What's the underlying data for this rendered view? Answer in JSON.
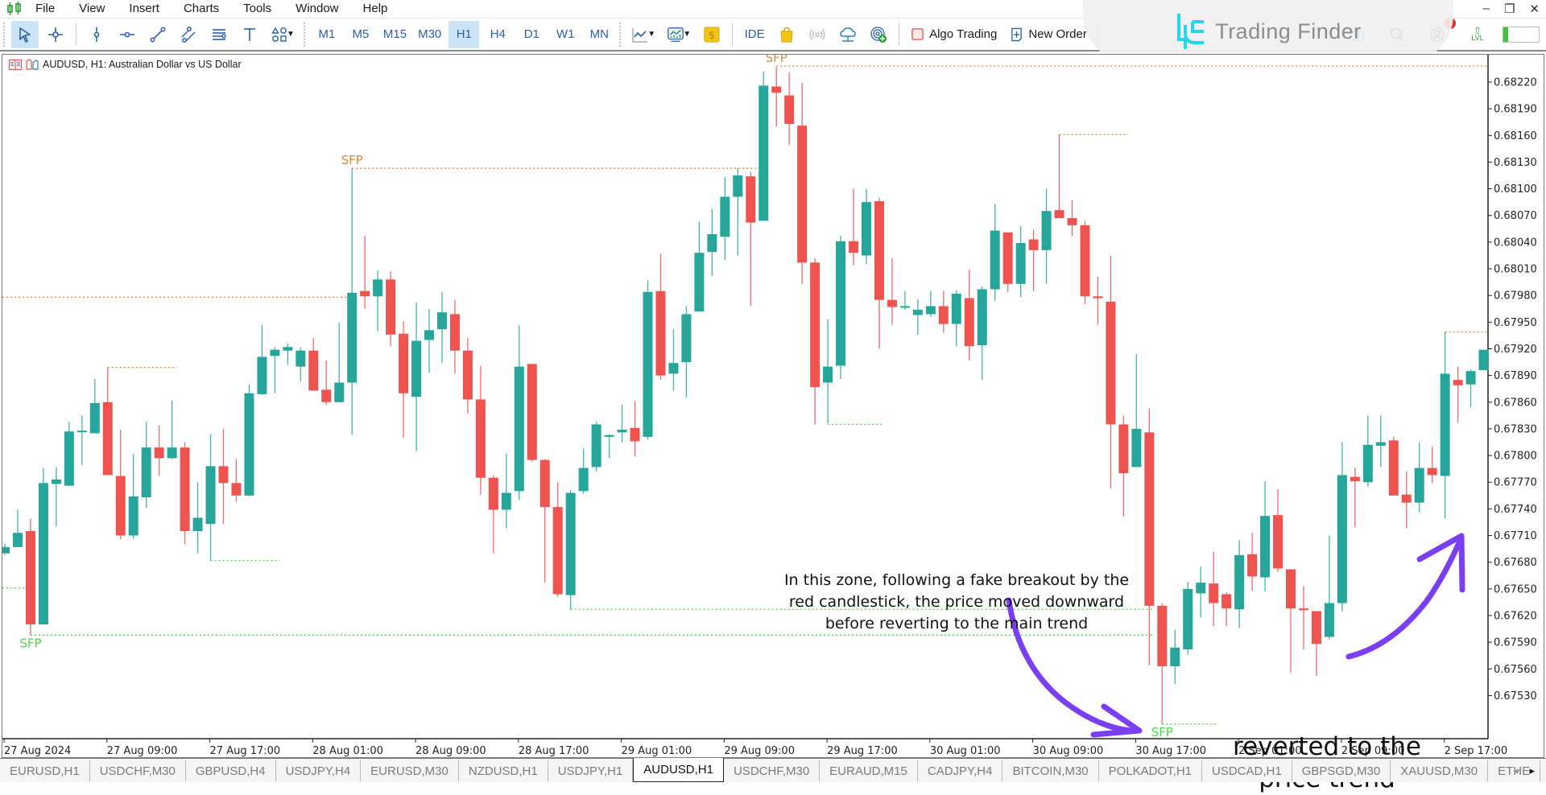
{
  "app": {
    "menu": [
      "File",
      "View",
      "Insert",
      "Charts",
      "Tools",
      "Window",
      "Help"
    ],
    "window_controls": {
      "minimize": "–",
      "restore": "❐",
      "close": "✕"
    }
  },
  "toolbar": {
    "drawing_tools": [
      "cursor-icon",
      "crosshair-icon",
      "vertical-line-icon",
      "horizontal-line-icon",
      "trendline-icon",
      "equidistant-channel-icon",
      "fibonacci-icon",
      "text-icon",
      "shapes-icon"
    ],
    "timeframes": [
      "M1",
      "M5",
      "M15",
      "M30",
      "H1",
      "H4",
      "D1",
      "W1",
      "MN"
    ],
    "active_timeframe": "H1",
    "ide_label": "IDE",
    "algo_trading_label": "Algo Trading",
    "new_order_label": "New Order",
    "notification_count": "1",
    "level_label": "LVL"
  },
  "watermark": {
    "brand": "Trading Finder"
  },
  "chart": {
    "title": "AUDUSD, H1:  Australian Dollar vs US Dollar",
    "symbol": "AUDUSD",
    "timeframe": "H1",
    "colors": {
      "bull": "#26a69a",
      "bear": "#ef5350",
      "sfp_high": "#e08a3c",
      "sfp_low": "#4cd94c",
      "arrow": "#7b3ff2"
    }
  },
  "annotations": {
    "zone_note": "In this zone, following a fake breakout by the red candlestick, the price moved downward before reverting to the main trend",
    "trend_note": "reverted to the price trend"
  },
  "tabs": [
    {
      "label": "EURUSD,H1",
      "active": false
    },
    {
      "label": "USDCHF,M30",
      "active": false
    },
    {
      "label": "GBPUSD,H4",
      "active": false
    },
    {
      "label": "USDJPY,H4",
      "active": false
    },
    {
      "label": "EURUSD,M30",
      "active": false
    },
    {
      "label": "NZDUSD,H1",
      "active": false
    },
    {
      "label": "USDJPY,H1",
      "active": false
    },
    {
      "label": "AUDUSD,H1",
      "active": true
    },
    {
      "label": "USDCHF,M30",
      "active": false
    },
    {
      "label": "EURAUD,M15",
      "active": false
    },
    {
      "label": "CADJPY,H4",
      "active": false
    },
    {
      "label": "BITCOIN,M30",
      "active": false
    },
    {
      "label": "POLKADOT,H1",
      "active": false
    },
    {
      "label": "USDCAD,H1",
      "active": false
    },
    {
      "label": "GBPSGD,M30",
      "active": false
    },
    {
      "label": "XAUUSD,M30",
      "active": false
    },
    {
      "label": "ETHE",
      "active": false
    }
  ],
  "chart_data": {
    "type": "candlestick",
    "title": "AUDUSD, H1: Australian Dollar vs US Dollar",
    "xlabel": "",
    "ylabel": "",
    "ylim": [
      0.67482,
      0.68244
    ],
    "grid": false,
    "y_ticks": [
      "0.68220",
      "0.68190",
      "0.68160",
      "0.68130",
      "0.68100",
      "0.68070",
      "0.68040",
      "0.68010",
      "0.67980",
      "0.67950",
      "0.67920",
      "0.67890",
      "0.67860",
      "0.67830",
      "0.67800",
      "0.67770",
      "0.67740",
      "0.67710",
      "0.67680",
      "0.67650",
      "0.67620",
      "0.67590",
      "0.67560",
      "0.67530"
    ],
    "x_ticks": [
      {
        "label": "27 Aug 2024",
        "bar": 0
      },
      {
        "label": "27 Aug 09:00",
        "bar": 8
      },
      {
        "label": "27 Aug 17:00",
        "bar": 16
      },
      {
        "label": "28 Aug 01:00",
        "bar": 24
      },
      {
        "label": "28 Aug 09:00",
        "bar": 32
      },
      {
        "label": "28 Aug 17:00",
        "bar": 40
      },
      {
        "label": "29 Aug 01:00",
        "bar": 48
      },
      {
        "label": "29 Aug 09:00",
        "bar": 56
      },
      {
        "label": "29 Aug 17:00",
        "bar": 64
      },
      {
        "label": "30 Aug 01:00",
        "bar": 72
      },
      {
        "label": "30 Aug 09:00",
        "bar": 80
      },
      {
        "label": "30 Aug 17:00",
        "bar": 88
      },
      {
        "label": "2 Sep 01:00",
        "bar": 96
      },
      {
        "label": "2 Sep 09:00",
        "bar": 104
      },
      {
        "label": "2 Sep 17:00",
        "bar": 112
      }
    ],
    "ohlc_fields": [
      "open",
      "high",
      "low",
      "close"
    ],
    "candles": [
      [
        0.6769,
        0.67701,
        0.67688,
        0.67697
      ],
      [
        0.67697,
        0.67739,
        0.67697,
        0.67713
      ],
      [
        0.67715,
        0.67729,
        0.67598,
        0.6761
      ],
      [
        0.6761,
        0.67786,
        0.6761,
        0.67769
      ],
      [
        0.67768,
        0.67787,
        0.6772,
        0.67773
      ],
      [
        0.67766,
        0.67838,
        0.67766,
        0.67827
      ],
      [
        0.67827,
        0.67845,
        0.67789,
        0.67828
      ],
      [
        0.67825,
        0.67886,
        0.67825,
        0.67859
      ],
      [
        0.6786,
        0.67899,
        0.67778,
        0.67778
      ],
      [
        0.67777,
        0.67829,
        0.67706,
        0.6771
      ],
      [
        0.6771,
        0.67802,
        0.67706,
        0.67754
      ],
      [
        0.67753,
        0.67838,
        0.67741,
        0.67809
      ],
      [
        0.67809,
        0.67834,
        0.67777,
        0.67797
      ],
      [
        0.67797,
        0.67862,
        0.67796,
        0.67809
      ],
      [
        0.67809,
        0.67815,
        0.677,
        0.67715
      ],
      [
        0.67715,
        0.6777,
        0.6769,
        0.6773
      ],
      [
        0.67723,
        0.67824,
        0.67682,
        0.67788
      ],
      [
        0.67788,
        0.6783,
        0.67723,
        0.67769
      ],
      [
        0.67769,
        0.67796,
        0.67748,
        0.67755
      ],
      [
        0.67755,
        0.6788,
        0.67754,
        0.6787
      ],
      [
        0.67869,
        0.67947,
        0.67868,
        0.67911
      ],
      [
        0.67912,
        0.67922,
        0.6787,
        0.67919
      ],
      [
        0.67918,
        0.67926,
        0.67902,
        0.67922
      ],
      [
        0.679,
        0.67922,
        0.67883,
        0.67918
      ],
      [
        0.67918,
        0.67932,
        0.67873,
        0.67873
      ],
      [
        0.67874,
        0.67907,
        0.67857,
        0.6786
      ],
      [
        0.6786,
        0.67949,
        0.6786,
        0.67882
      ],
      [
        0.67882,
        0.68123,
        0.67823,
        0.67983
      ],
      [
        0.67985,
        0.68047,
        0.67965,
        0.67979
      ],
      [
        0.67979,
        0.68008,
        0.6794,
        0.67998
      ],
      [
        0.67998,
        0.68007,
        0.67923,
        0.67936
      ],
      [
        0.67937,
        0.67951,
        0.6782,
        0.6787
      ],
      [
        0.67866,
        0.67972,
        0.67805,
        0.67929
      ],
      [
        0.6793,
        0.67965,
        0.67893,
        0.67941
      ],
      [
        0.67942,
        0.67984,
        0.67904,
        0.67961
      ],
      [
        0.67959,
        0.67975,
        0.67892,
        0.67918
      ],
      [
        0.67918,
        0.67932,
        0.67847,
        0.67863
      ],
      [
        0.67863,
        0.67901,
        0.67756,
        0.67775
      ],
      [
        0.67775,
        0.67778,
        0.6769,
        0.67739
      ],
      [
        0.67739,
        0.67802,
        0.67718,
        0.67758
      ],
      [
        0.6776,
        0.67946,
        0.6775,
        0.679
      ],
      [
        0.67903,
        0.67903,
        0.67793,
        0.67795
      ],
      [
        0.67795,
        0.67796,
        0.67657,
        0.67742
      ],
      [
        0.67742,
        0.6777,
        0.67641,
        0.67644
      ],
      [
        0.67643,
        0.67761,
        0.67627,
        0.67758
      ],
      [
        0.6776,
        0.67808,
        0.67757,
        0.67786
      ],
      [
        0.67787,
        0.67838,
        0.67782,
        0.67835
      ],
      [
        0.67821,
        0.67824,
        0.67797,
        0.67823
      ],
      [
        0.67826,
        0.67857,
        0.67815,
        0.67829
      ],
      [
        0.67831,
        0.67861,
        0.67799,
        0.67816
      ],
      [
        0.67821,
        0.67997,
        0.67818,
        0.67984
      ],
      [
        0.67985,
        0.68027,
        0.67885,
        0.6789
      ],
      [
        0.67892,
        0.67942,
        0.67873,
        0.67904
      ],
      [
        0.67905,
        0.67968,
        0.67865,
        0.67959
      ],
      [
        0.67962,
        0.68063,
        0.67962,
        0.68028
      ],
      [
        0.68029,
        0.68077,
        0.68002,
        0.68049
      ],
      [
        0.68046,
        0.68113,
        0.6802,
        0.68091
      ],
      [
        0.68091,
        0.68123,
        0.68025,
        0.68115
      ],
      [
        0.68114,
        0.68119,
        0.67968,
        0.68062
      ],
      [
        0.68064,
        0.68232,
        0.68064,
        0.68216
      ],
      [
        0.68215,
        0.68237,
        0.6817,
        0.68208
      ],
      [
        0.68205,
        0.68231,
        0.68149,
        0.68173
      ],
      [
        0.68171,
        0.68219,
        0.67993,
        0.68017
      ],
      [
        0.68017,
        0.68022,
        0.67835,
        0.67877
      ],
      [
        0.67882,
        0.67953,
        0.67836,
        0.679
      ],
      [
        0.67901,
        0.68047,
        0.67886,
        0.68041
      ],
      [
        0.68041,
        0.681,
        0.68014,
        0.68028
      ],
      [
        0.68025,
        0.681,
        0.68015,
        0.68085
      ],
      [
        0.68086,
        0.6809,
        0.6792,
        0.67975
      ],
      [
        0.67975,
        0.68022,
        0.67947,
        0.67967
      ],
      [
        0.67967,
        0.67985,
        0.67964,
        0.67968
      ],
      [
        0.67958,
        0.67976,
        0.67936,
        0.67964
      ],
      [
        0.67959,
        0.67985,
        0.67956,
        0.67968
      ],
      [
        0.67968,
        0.67985,
        0.67938,
        0.67948
      ],
      [
        0.67948,
        0.67986,
        0.67923,
        0.67982
      ],
      [
        0.67977,
        0.68009,
        0.67907,
        0.67923
      ],
      [
        0.67924,
        0.6799,
        0.67885,
        0.67987
      ],
      [
        0.67987,
        0.68083,
        0.67974,
        0.68053
      ],
      [
        0.68051,
        0.68051,
        0.67984,
        0.67993
      ],
      [
        0.67993,
        0.68058,
        0.67978,
        0.68039
      ],
      [
        0.68043,
        0.68054,
        0.67985,
        0.68031
      ],
      [
        0.68031,
        0.681,
        0.67993,
        0.68075
      ],
      [
        0.68076,
        0.68161,
        0.68067,
        0.68067
      ],
      [
        0.68067,
        0.68087,
        0.68047,
        0.68059
      ],
      [
        0.68059,
        0.68064,
        0.6797,
        0.67979
      ],
      [
        0.67979,
        0.68001,
        0.67947,
        0.67977
      ],
      [
        0.67973,
        0.68025,
        0.67763,
        0.67835
      ],
      [
        0.67835,
        0.67845,
        0.67731,
        0.6778
      ],
      [
        0.67787,
        0.67914,
        0.67787,
        0.6783
      ],
      [
        0.67826,
        0.67853,
        0.67564,
        0.67631
      ],
      [
        0.67631,
        0.67634,
        0.67498,
        0.67563
      ],
      [
        0.67563,
        0.67604,
        0.67543,
        0.67584
      ],
      [
        0.67582,
        0.67658,
        0.67576,
        0.6765
      ],
      [
        0.67645,
        0.67675,
        0.67618,
        0.67657
      ],
      [
        0.67656,
        0.67692,
        0.67608,
        0.67634
      ],
      [
        0.67644,
        0.67646,
        0.67608,
        0.67628
      ],
      [
        0.67627,
        0.67705,
        0.67606,
        0.67688
      ],
      [
        0.67689,
        0.67713,
        0.67648,
        0.67664
      ],
      [
        0.67663,
        0.67771,
        0.67647,
        0.67732
      ],
      [
        0.67733,
        0.67762,
        0.67669,
        0.67673
      ],
      [
        0.67672,
        0.67672,
        0.67556,
        0.67628
      ],
      [
        0.67628,
        0.67653,
        0.67582,
        0.67626
      ],
      [
        0.67625,
        0.67625,
        0.67552,
        0.67588
      ],
      [
        0.67596,
        0.6771,
        0.67593,
        0.67634
      ],
      [
        0.67634,
        0.67815,
        0.67625,
        0.67778
      ],
      [
        0.67776,
        0.67786,
        0.67719,
        0.67771
      ],
      [
        0.6777,
        0.67845,
        0.67765,
        0.67812
      ],
      [
        0.67811,
        0.67845,
        0.67787,
        0.67815
      ],
      [
        0.67817,
        0.67821,
        0.67755,
        0.67755
      ],
      [
        0.67756,
        0.67782,
        0.67718,
        0.67747
      ],
      [
        0.67747,
        0.67815,
        0.67736,
        0.67786
      ],
      [
        0.67786,
        0.6781,
        0.67769,
        0.67778
      ],
      [
        0.67777,
        0.67939,
        0.67729,
        0.67892
      ],
      [
        0.67885,
        0.679,
        0.67837,
        0.67879
      ],
      [
        0.6788,
        0.67897,
        0.67854,
        0.67895
      ],
      [
        0.67896,
        0.67919,
        0.67896,
        0.67919
      ]
    ],
    "sfp_levels": [
      {
        "type": "high",
        "price": 0.68238,
        "from_bar": 60,
        "to_bar": 115,
        "label": "SFP"
      },
      {
        "type": "high",
        "price": 0.68123,
        "from_bar": 27,
        "to_bar": 59,
        "label": "SFP"
      },
      {
        "type": "high",
        "price": 0.67978,
        "from_bar": 0,
        "to_bar": 27,
        "label": ""
      },
      {
        "type": "high",
        "price": 0.67899,
        "from_bar": 8,
        "to_bar": 13,
        "label": ""
      },
      {
        "type": "high",
        "price": 0.68161,
        "from_bar": 82,
        "to_bar": 87,
        "label": ""
      },
      {
        "type": "high",
        "price": 0.67939,
        "from_bar": 112,
        "to_bar": 115,
        "label": ""
      },
      {
        "type": "low",
        "price": 0.67651,
        "from_bar": 0,
        "to_bar": 2,
        "label": ""
      },
      {
        "type": "low",
        "price": 0.67598,
        "from_bar": 2,
        "to_bar": 89,
        "label": "SFP"
      },
      {
        "type": "low",
        "price": 0.67682,
        "from_bar": 16,
        "to_bar": 21,
        "label": ""
      },
      {
        "type": "low",
        "price": 0.67627,
        "from_bar": 44,
        "to_bar": 89,
        "label": ""
      },
      {
        "type": "low",
        "price": 0.67835,
        "from_bar": 64,
        "to_bar": 68,
        "label": ""
      },
      {
        "type": "low",
        "price": 0.67498,
        "from_bar": 90,
        "to_bar": 94,
        "label": "SFP"
      }
    ]
  }
}
